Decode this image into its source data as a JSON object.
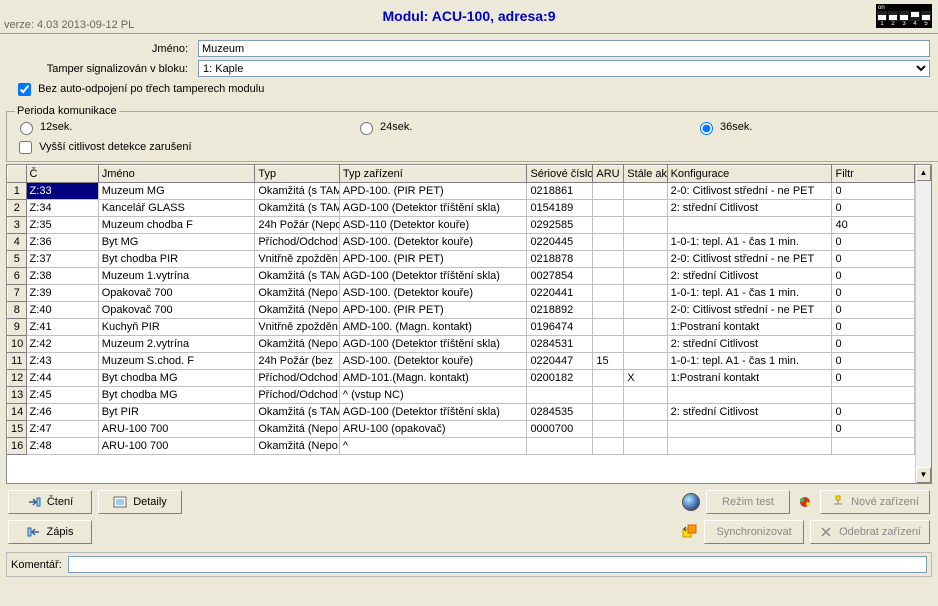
{
  "version": "verze: 4.03 2013-09-12 PL",
  "title": "Modul: ACU-100, adresa:9",
  "dip": {
    "on_label": "on",
    "switches": [
      false,
      false,
      false,
      true,
      false
    ],
    "numbers": [
      "1",
      "2",
      "3",
      "4",
      "5"
    ]
  },
  "form": {
    "name_label": "Jméno:",
    "name_value": "Muzeum",
    "tamper_label": "Tamper signalizován v bloku:",
    "tamper_value": "1: Kaple",
    "auto_disconnect_label": "Bez auto-odpojení po třech tamperech modulu",
    "auto_disconnect_checked": true
  },
  "period": {
    "legend": "Perioda komunikace",
    "opt12": "12sek.",
    "opt24": "24sek.",
    "opt36": "36sek.",
    "selected": "36",
    "high_sens_label": "Vyšší citlivost detekce zarušení",
    "high_sens_checked": false
  },
  "columns": {
    "c": "Č",
    "name": "Jméno",
    "typ": "Typ",
    "typzar": "Typ zařízení",
    "ser": "Sériové číslo",
    "aru": "ARU",
    "stale": "Stále ak",
    "konf": "Konfigurace",
    "filtr": "Filtr"
  },
  "rows": [
    {
      "n": "1",
      "c": "Z:33",
      "name": "Muzeum MG",
      "typ": "Okamžitá (s TAM",
      "typzar": "APD-100. (PIR PET)",
      "ser": "0218861",
      "aru": "",
      "stale": "",
      "konf": "2-0: Citlivost střední - ne PET",
      "filtr": "0",
      "sel": true
    },
    {
      "n": "2",
      "c": "Z:34",
      "name": "Kancelář GLASS",
      "typ": "Okamžitá (s TAM",
      "typzar": "AGD-100 (Detektor tříštění skla)",
      "ser": "0154189",
      "aru": "",
      "stale": "",
      "konf": "2: střední Citlivost",
      "filtr": "0"
    },
    {
      "n": "3",
      "c": "Z:35",
      "name": "Muzeum chodba F",
      "typ": "24h Požár (Nepo",
      "typzar": "ASD-110  (Detektor kouře)",
      "ser": "0292585",
      "aru": "",
      "stale": "",
      "konf": "",
      "filtr": "40"
    },
    {
      "n": "4",
      "c": "Z:36",
      "name": "Byt MG",
      "typ": "Příchod/Odchod",
      "typzar": "ASD-100. (Detektor kouře)",
      "ser": "0220445",
      "aru": "",
      "stale": "",
      "konf": "1-0-1: tepl. A1 - čas 1 min.",
      "filtr": "0"
    },
    {
      "n": "5",
      "c": "Z:37",
      "name": "Byt chodba PIR",
      "typ": "Vnitřně zpožděn",
      "typzar": "APD-100. (PIR PET)",
      "ser": "0218878",
      "aru": "",
      "stale": "",
      "konf": "2-0: Citlivost střední - ne PET",
      "filtr": "0"
    },
    {
      "n": "6",
      "c": "Z:38",
      "name": "Muzeum 1.vytrína",
      "typ": "Okamžitá (s TAM",
      "typzar": "AGD-100 (Detektor tříštění skla)",
      "ser": "0027854",
      "aru": "",
      "stale": "",
      "konf": "2: střední Citlivost",
      "filtr": "0"
    },
    {
      "n": "7",
      "c": "Z:39",
      "name": "Opakovač 700",
      "typ": "Okamžitá (Nepo",
      "typzar": "ASD-100. (Detektor kouře)",
      "ser": "0220441",
      "aru": "",
      "stale": "",
      "konf": "1-0-1: tepl. A1 - čas 1 min.",
      "filtr": "0"
    },
    {
      "n": "8",
      "c": "Z:40",
      "name": "Opakovač 700",
      "typ": "Okamžitá (Nepo",
      "typzar": "APD-100. (PIR PET)",
      "ser": "0218892",
      "aru": "",
      "stale": "",
      "konf": "2-0: Citlivost střední - ne PET",
      "filtr": "0"
    },
    {
      "n": "9",
      "c": "Z:41",
      "name": "Kuchyň PIR",
      "typ": "Vnitřně zpožděn",
      "typzar": "AMD-100. (Magn. kontakt)",
      "ser": "0196474",
      "aru": "",
      "stale": "",
      "konf": "1:Postraní kontakt",
      "filtr": "0"
    },
    {
      "n": "10",
      "c": "Z:42",
      "name": "Muzeum 2.vytrína",
      "typ": "Okamžitá (Nepo",
      "typzar": "AGD-100 (Detektor tříštění skla)",
      "ser": "0284531",
      "aru": "",
      "stale": "",
      "konf": "2: střední Citlivost",
      "filtr": "0"
    },
    {
      "n": "11",
      "c": "Z:43",
      "name": "Muzeum S.chod. F",
      "typ": "24h Požár (bez",
      "typzar": "ASD-100. (Detektor kouře)",
      "ser": "0220447",
      "aru": "15",
      "stale": "",
      "konf": "1-0-1: tepl. A1 - čas 1 min.",
      "filtr": "0"
    },
    {
      "n": "12",
      "c": "Z:44",
      "name": "Byt chodba MG",
      "typ": "Příchod/Odchod",
      "typzar": "AMD-101.(Magn. kontakt)",
      "ser": "0200182",
      "aru": "",
      "stale": "X",
      "konf": "1:Postraní kontakt",
      "filtr": "0"
    },
    {
      "n": "13",
      "c": "Z:45",
      "name": "Byt chodba MG",
      "typ": "Příchod/Odchod",
      "typzar": "^             (vstup NC)",
      "ser": "",
      "aru": "",
      "stale": "",
      "konf": "",
      "filtr": ""
    },
    {
      "n": "14",
      "c": "Z:46",
      "name": "Byt PIR",
      "typ": "Okamžitá (s TAM",
      "typzar": "AGD-100 (Detektor tříštění skla)",
      "ser": "0284535",
      "aru": "",
      "stale": "",
      "konf": "2: střední Citlivost",
      "filtr": "0"
    },
    {
      "n": "15",
      "c": "Z:47",
      "name": "ARU-100 700",
      "typ": "Okamžitá (Nepo",
      "typzar": "ARU-100  (opakovač)",
      "ser": "0000700",
      "aru": "",
      "stale": "",
      "konf": "",
      "filtr": "0"
    },
    {
      "n": "16",
      "c": "Z:48",
      "name": "ARU-100 700",
      "typ": "Okamžitá (Nepo",
      "typzar": "^",
      "ser": "",
      "aru": "",
      "stale": "",
      "konf": "",
      "filtr": ""
    }
  ],
  "buttons": {
    "read": "Čtení",
    "write": "Zápis",
    "details": "Detaily",
    "test": "Režim test",
    "sync": "Synchronizovat",
    "new": "Nové zařízení",
    "remove": "Odebrat zařízení"
  },
  "comment": {
    "label": "Komentář:",
    "value": ""
  }
}
